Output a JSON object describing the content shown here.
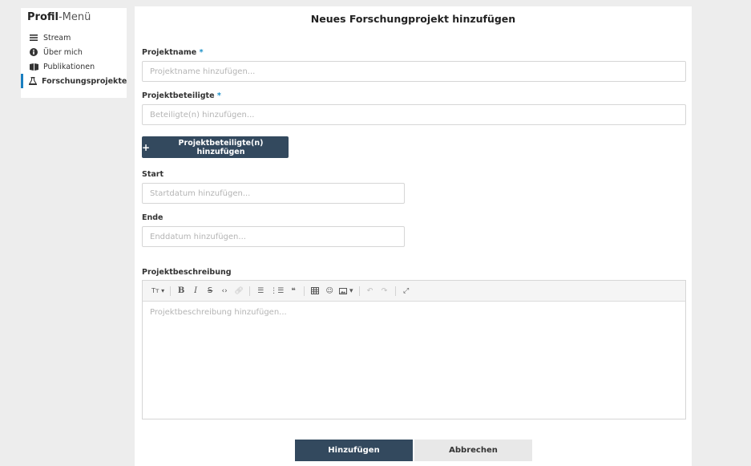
{
  "sidebar": {
    "title_bold": "Profil",
    "title_rest": "-Menü",
    "items": [
      {
        "label": "Stream",
        "icon": "list-icon"
      },
      {
        "label": "Über mich",
        "icon": "info-icon"
      },
      {
        "label": "Publikationen",
        "icon": "book-icon"
      },
      {
        "label": "Forschungsprojekte",
        "icon": "flask-icon",
        "active": true
      }
    ]
  },
  "form": {
    "title": "Neues Forschungprojekt hinzufügen",
    "project_name": {
      "label": "Projektname",
      "required_mark": "*",
      "placeholder": "Projektname hinzufügen...",
      "value": ""
    },
    "participants": {
      "label": "Projektbeteiligte",
      "required_mark": "*",
      "placeholder": "Beteiligte(n) hinzufügen...",
      "value": ""
    },
    "add_participant_button": {
      "icon": "plus-icon",
      "label": "Projektbeteiligte(n) hinzufügen"
    },
    "start": {
      "label": "Start",
      "placeholder": "Startdatum hinzufügen...",
      "value": ""
    },
    "end": {
      "label": "Ende",
      "placeholder": "Enddatum hinzufügen...",
      "value": ""
    },
    "description": {
      "label": "Projektbeschreibung",
      "placeholder": "Projektbeschreibung hinzufügen...",
      "toolbar": [
        "text-size-icon",
        "bold-icon",
        "italic-icon",
        "strikethrough-icon",
        "code-icon",
        "link-icon",
        "unordered-list-icon",
        "ordered-list-icon",
        "quote-icon",
        "table-icon",
        "emoji-icon",
        "image-icon",
        "undo-icon",
        "redo-icon",
        "fullscreen-icon"
      ]
    },
    "submit_label": "Hinzufügen",
    "cancel_label": "Abbrechen"
  },
  "colors": {
    "primary": "#33495e",
    "accent": "#1a8fc7",
    "background": "#ededed"
  }
}
